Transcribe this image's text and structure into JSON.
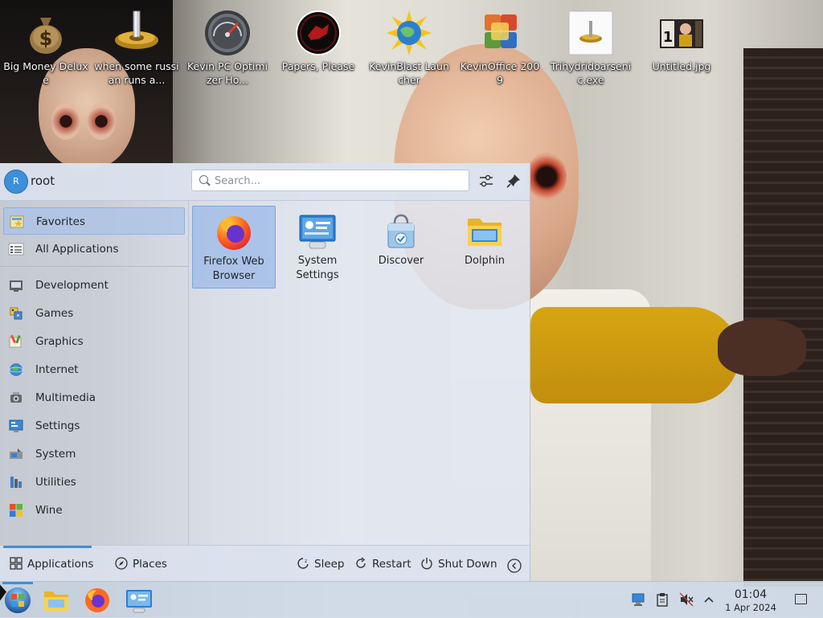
{
  "desktop": {
    "icons": [
      {
        "label": "Big Money Deluxe"
      },
      {
        "label": "when some russian runs a..."
      },
      {
        "label": "Kevin PC Optimizer Ho..."
      },
      {
        "label": "Papers, Please"
      },
      {
        "label": "KevinBlast Launcher"
      },
      {
        "label": "KevinOffice 2009"
      },
      {
        "label": "Trihydridoarsenic.exe"
      },
      {
        "label": "Untitled.jpg"
      }
    ]
  },
  "launcher": {
    "user": {
      "avatar_initial": "R",
      "name": "root"
    },
    "search": {
      "placeholder": "Search...",
      "value": ""
    },
    "categories": [
      {
        "label": "Favorites",
        "active": true
      },
      {
        "label": "All Applications"
      },
      {
        "label": "Development"
      },
      {
        "label": "Games"
      },
      {
        "label": "Graphics"
      },
      {
        "label": "Internet"
      },
      {
        "label": "Multimedia"
      },
      {
        "label": "Settings"
      },
      {
        "label": "System"
      },
      {
        "label": "Utilities"
      },
      {
        "label": "Wine"
      }
    ],
    "favorites": [
      {
        "label": "Firefox Web Browser",
        "active": true
      },
      {
        "label": "System Settings"
      },
      {
        "label": "Discover"
      },
      {
        "label": "Dolphin"
      }
    ],
    "footer": {
      "tabs": [
        {
          "label": "Applications",
          "active": true
        },
        {
          "label": "Places"
        }
      ],
      "actions": [
        {
          "label": "Sleep"
        },
        {
          "label": "Restart"
        },
        {
          "label": "Shut Down"
        }
      ]
    }
  },
  "taskbar": {
    "clock": {
      "time": "01:04",
      "date": "1 Apr 2024"
    }
  },
  "colors": {
    "accent": "#3d8fd9",
    "launcher_bg": "#e2e8f2",
    "taskbar_bg": "#d0dae8"
  }
}
